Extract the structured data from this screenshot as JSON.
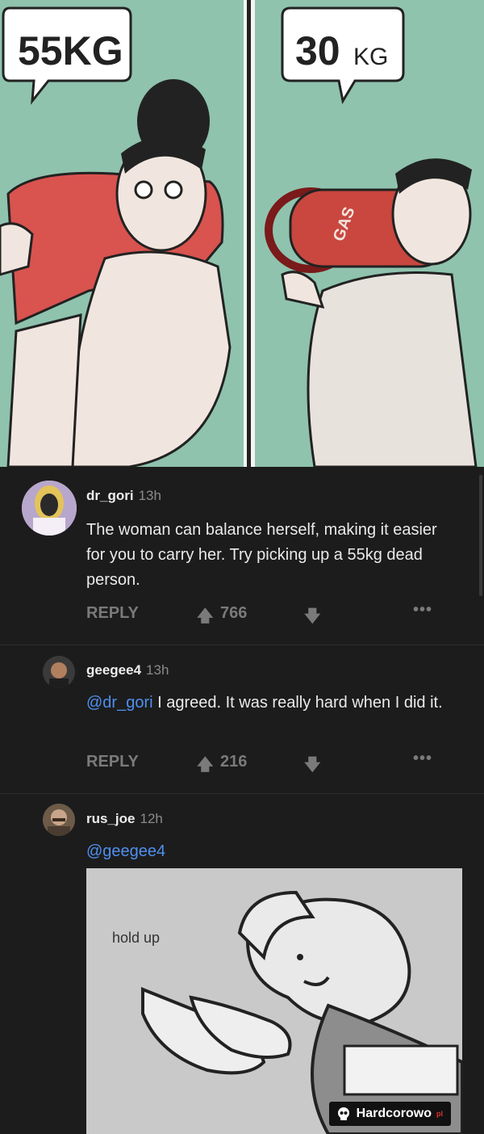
{
  "comic": {
    "left_weight": "55KG",
    "right_weight_num": "30",
    "right_weight_unit": "KG",
    "gas_label": "GAS"
  },
  "comments": [
    {
      "username": "dr_gori",
      "time": "13h",
      "text": "The woman can balance herself, making it easier for you to carry her. Try picking up a 55kg dead person.",
      "reply_label": "REPLY",
      "upvotes": "766"
    },
    {
      "username": "geegee4",
      "time": "13h",
      "mention": "@dr_gori",
      "text": " I agreed. It was really hard when I did it.",
      "reply_label": "REPLY",
      "upvotes": "216"
    },
    {
      "username": "rus_joe",
      "time": "12h",
      "mention": "@geegee4",
      "image_caption": "hold up"
    }
  ],
  "watermark": {
    "brand": "Hardcorowo",
    "tld": "pl"
  },
  "colors": {
    "mention": "#4f8ff0",
    "background": "#1c1c1c",
    "comic_bg": "#8fc3ae"
  }
}
